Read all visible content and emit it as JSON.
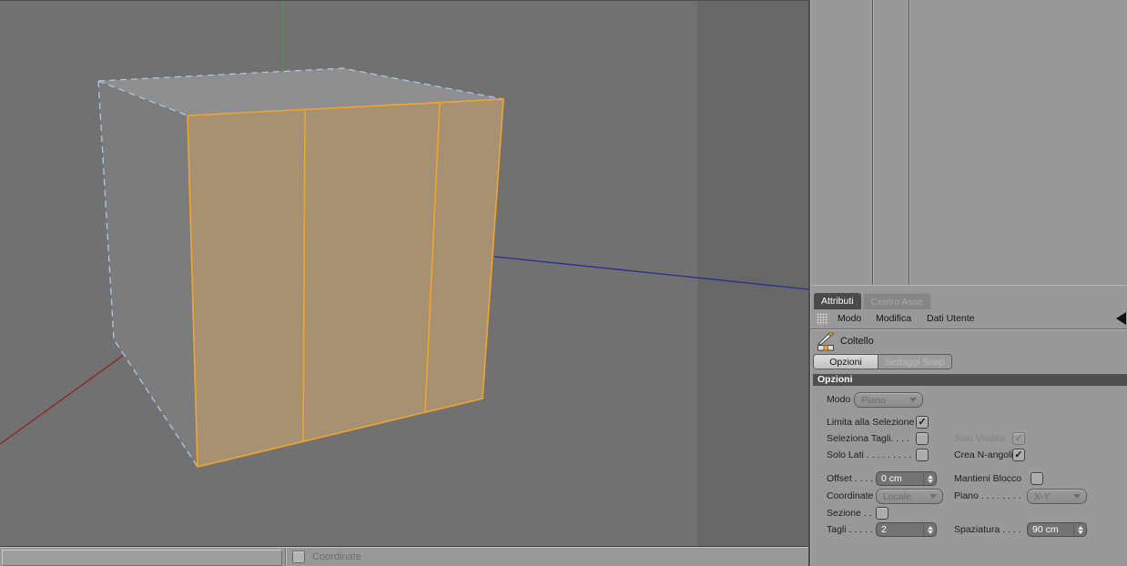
{
  "glyphs": {
    "check": "✓"
  },
  "colors": {
    "viewport_bg": "#717171",
    "viewport_dark_band": "#676767",
    "panel_bg": "#999999",
    "selection_orange": "#f2a42e",
    "selected_face_tan": "#a69173",
    "wireframe_blue": "#aac9e6",
    "axis_x_red": "#8b2424",
    "axis_y_green": "#4e8f4e",
    "axis_z_blue": "#2b2b96",
    "section_header_bg": "#4f4f4f"
  },
  "viewport": {
    "statusbar": {
      "coordinate_label": "Coordinate"
    }
  },
  "panel": {
    "tabs": {
      "attributi": "Attributi",
      "centro_asse": "Centro Asse"
    },
    "menu": {
      "modo": "Modo",
      "modifica": "Modifica",
      "dati_utente": "Dati Utente"
    },
    "tool": {
      "name": "Coltello"
    },
    "mode_buttons": {
      "opzioni": "Opzioni",
      "settaggi_snap": "Settaggi Snap"
    },
    "section_title": "Opzioni",
    "controls": {
      "modo_label": "Modo",
      "modo_value": "Piano",
      "limita_label": "Limita alla Selezione",
      "limita_checked": true,
      "seleziona_label": "Seleziona Tagli. . . .",
      "seleziona_checked": false,
      "solo_visibile_label": "Solo Visibile",
      "solo_visibile_checked": true,
      "solo_visibile_disabled": true,
      "solo_lati_label": "Solo Lati . . . . . . . . .",
      "solo_lati_checked": false,
      "crea_n_angoli_label": "Crea N-angoli",
      "crea_n_angoli_checked": true,
      "offset_label": "Offset . . . .",
      "offset_value": "0 cm",
      "mantieni_blocco_label": "Mantieni Blocco",
      "mantieni_blocco_checked": false,
      "coordinate_label": "Coordinate",
      "coordinate_value": "Locale",
      "piano_label": "Piano . . . . . . . .",
      "piano_value": "X-Y",
      "sezione_label": "Sezione . .",
      "sezione_checked": false,
      "tagli_label": "Tagli . . . . .",
      "tagli_value": "2",
      "spaziatura_label": "Spaziatura . . . .",
      "spaziatura_value": "90 cm"
    }
  }
}
